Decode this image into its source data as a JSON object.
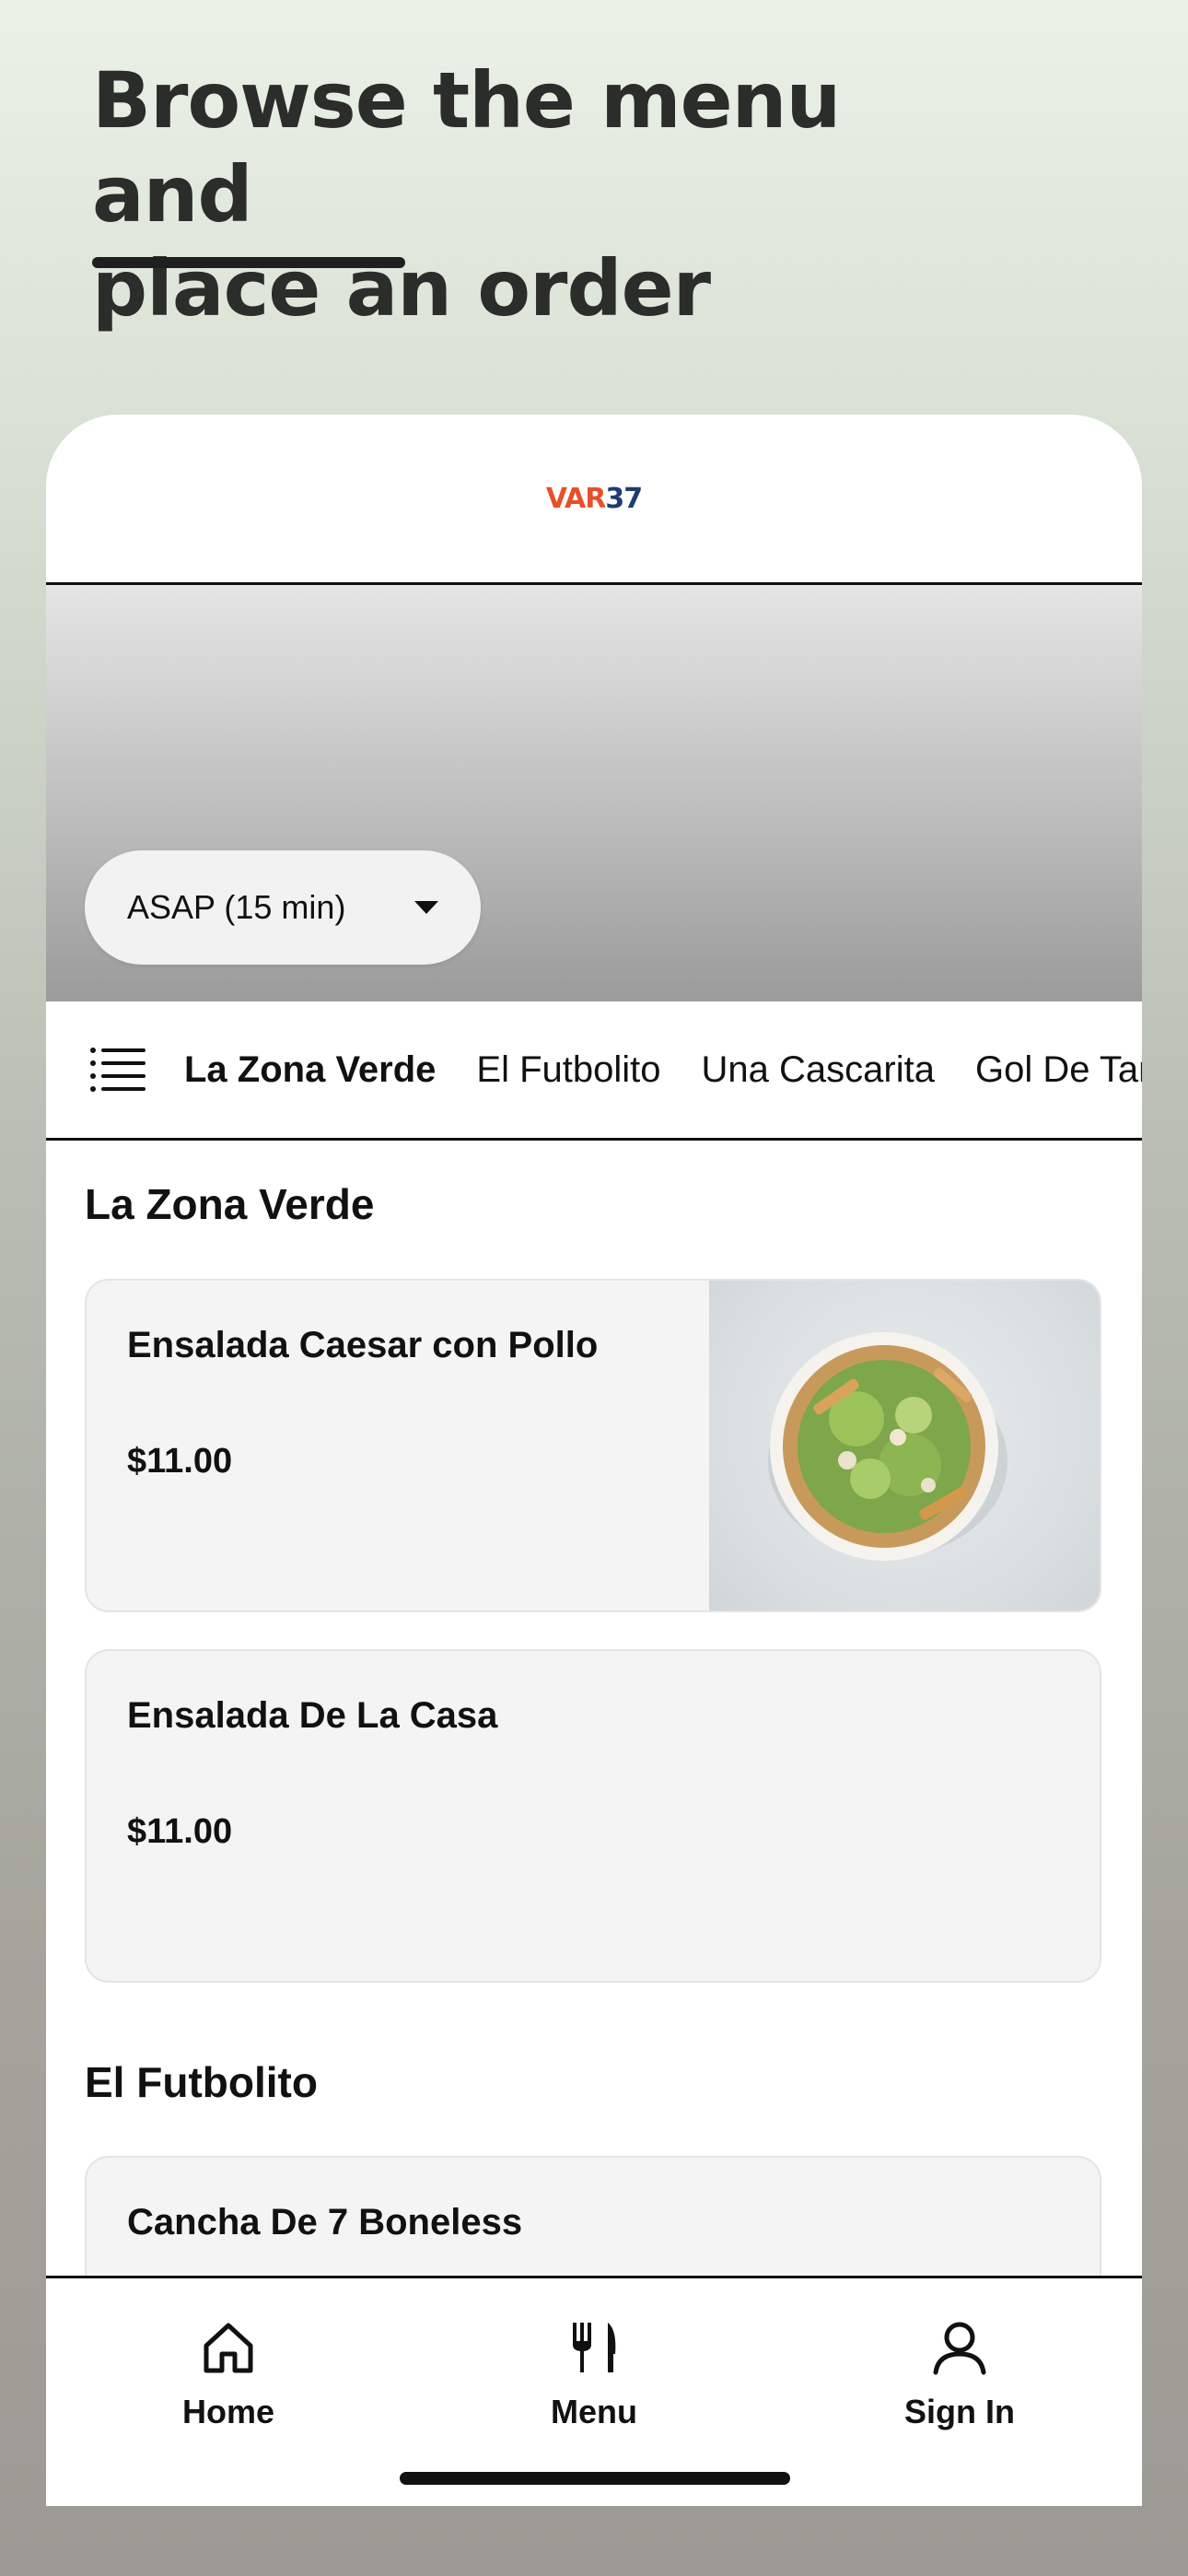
{
  "headline": {
    "line1": "Browse the menu and",
    "line2": "place an order"
  },
  "brand": {
    "logo_text_var": "VAR",
    "logo_text_num": "37",
    "logo_colors": {
      "var": "#e6512a",
      "num": "#1e3c6e"
    }
  },
  "order_time": {
    "selected": "ASAP (15 min)",
    "icon": "chevron-down-icon"
  },
  "categories": {
    "menu_icon": "list-icon",
    "tabs": [
      {
        "label": "La Zona Verde",
        "active": true
      },
      {
        "label": "El Futbolito",
        "active": false
      },
      {
        "label": "Una Cascarita",
        "active": false
      },
      {
        "label": "Gol De Tarde",
        "active": false
      }
    ]
  },
  "sections": [
    {
      "title": "La Zona Verde",
      "items": [
        {
          "name": "Ensalada Caesar con Pollo",
          "price": "$11.00",
          "has_image": true
        },
        {
          "name": "Ensalada De La Casa",
          "price": "$11.00",
          "has_image": false
        }
      ]
    },
    {
      "title": "El Futbolito",
      "items": [
        {
          "name": "Cancha De 7 Boneless",
          "price": "",
          "has_image": false
        }
      ]
    }
  ],
  "bottom_nav": {
    "items": [
      {
        "label": "Home",
        "icon": "home-icon"
      },
      {
        "label": "Menu",
        "icon": "fork-knife-icon"
      },
      {
        "label": "Sign In",
        "icon": "user-icon"
      }
    ]
  }
}
